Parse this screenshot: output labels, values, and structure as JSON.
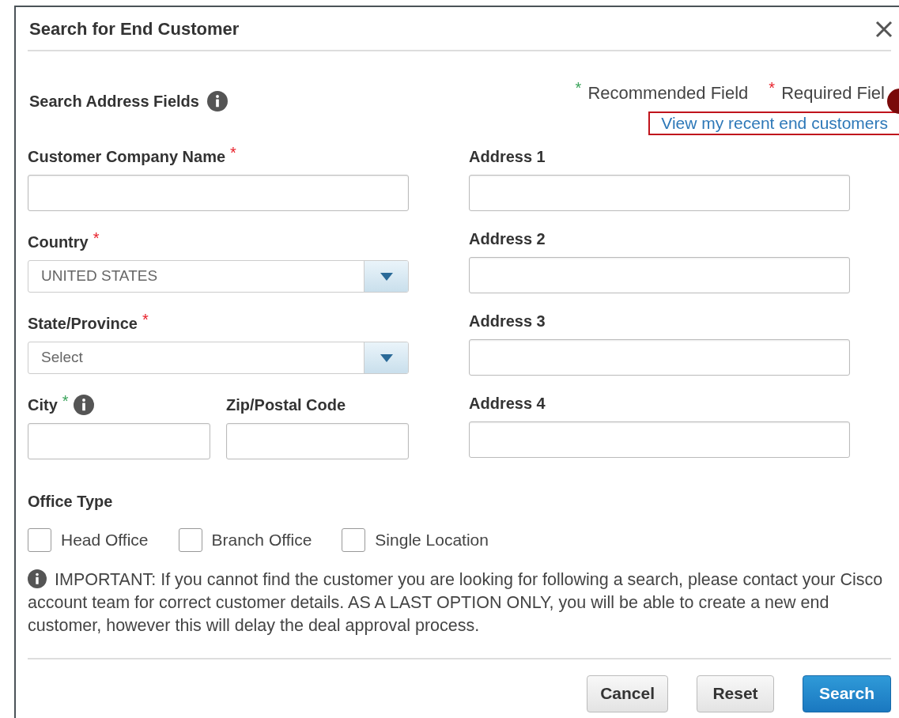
{
  "dialog": {
    "title": "Search for End Customer"
  },
  "section": {
    "title": "Search Address Fields"
  },
  "legend": [
    {
      "mark": "*",
      "label": "Recommended Field",
      "kind": "recommended"
    },
    {
      "mark": "*",
      "label": "Required Fiel",
      "kind": "required"
    }
  ],
  "recent_link": {
    "label": "View my recent end customers",
    "highlighted": true
  },
  "left_rows": [
    [
      {
        "label": "Customer Company Name",
        "kind": "text",
        "mark": {
          "text": "*",
          "kind": "required"
        }
      }
    ],
    [
      {
        "label": "Country",
        "kind": "select",
        "value": "UNITED STATES",
        "mark": {
          "text": "*",
          "kind": "required"
        }
      }
    ],
    [
      {
        "label": "State/Province",
        "kind": "select",
        "value": "Select",
        "mark": {
          "text": "*",
          "kind": "required"
        }
      }
    ],
    [
      {
        "label": "City",
        "kind": "text",
        "info": true,
        "mark": {
          "text": "*",
          "kind": "recommended"
        }
      },
      {
        "label": "Zip/Postal Code",
        "kind": "text"
      }
    ]
  ],
  "right_fields": [
    {
      "label": "Address 1",
      "kind": "text"
    },
    {
      "label": "Address 2",
      "kind": "text"
    },
    {
      "label": "Address 3",
      "kind": "text"
    },
    {
      "label": "Address 4",
      "kind": "text"
    }
  ],
  "office_type": {
    "title": "Office Type",
    "options": [
      {
        "label": "Head Office",
        "checked": false
      },
      {
        "label": "Branch Office",
        "checked": false
      },
      {
        "label": "Single Location",
        "checked": false
      }
    ]
  },
  "notice": "IMPORTANT: If you cannot find the customer you are looking for following a search, please contact your Cisco account team for correct customer details. AS A LAST OPTION ONLY, you will be able to create a new end customer, however this will delay the deal approval process.",
  "buttons": [
    {
      "label": "Cancel",
      "kind": "default"
    },
    {
      "label": "Reset",
      "kind": "default"
    },
    {
      "label": "Search",
      "kind": "primary"
    }
  ]
}
